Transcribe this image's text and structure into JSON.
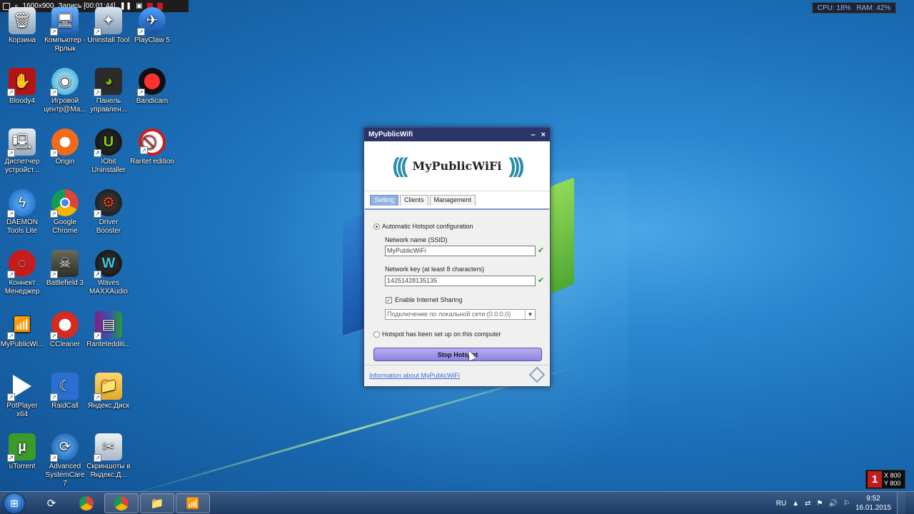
{
  "recorder": {
    "resolution": "1600x900",
    "recording": "Запись [00:01:44]"
  },
  "sysmon": {
    "cpu": "CPU: 18%",
    "ram": "RAM: 42%"
  },
  "desktop_icons": [
    {
      "label": "Корзина",
      "icon": "recycle-bin-icon"
    },
    {
      "label": "Компьютер - Ярлык",
      "icon": "computer-icon"
    },
    {
      "label": "Uninstall Tool",
      "icon": "uninstall-tool-icon"
    },
    {
      "label": "PlayClaw 5",
      "icon": "playclaw-icon"
    },
    {
      "label": "Bloody4",
      "icon": "bloody-icon"
    },
    {
      "label": "Игровой центр@Ma...",
      "icon": "game-center-icon"
    },
    {
      "label": "Панель управлен...",
      "icon": "nvidia-panel-icon"
    },
    {
      "label": "Bandicam",
      "icon": "bandicam-icon"
    },
    {
      "label": "Диспетчер устройст...",
      "icon": "device-manager-icon"
    },
    {
      "label": "Origin",
      "icon": "origin-icon"
    },
    {
      "label": "IObit Uninstaller",
      "icon": "iobit-icon"
    },
    {
      "label": "Raritet edition",
      "icon": "raritet-icon"
    },
    {
      "label": "DAEMON Tools Lite",
      "icon": "daemon-tools-icon"
    },
    {
      "label": "Google Chrome",
      "icon": "chrome-icon"
    },
    {
      "label": "Driver Booster",
      "icon": "driver-booster-icon"
    },
    {
      "label": "Коннект Менеджер",
      "icon": "connect-manager-icon"
    },
    {
      "label": "Battlefield 3",
      "icon": "battlefield-icon"
    },
    {
      "label": "Waves MAXXAudio",
      "icon": "waves-icon"
    },
    {
      "label": "MyPublicWi...",
      "icon": "mypublicwifi-icon"
    },
    {
      "label": "CCleaner",
      "icon": "ccleaner-icon"
    },
    {
      "label": "Raritetedditi...",
      "icon": "winrar-icon"
    },
    {
      "label": "PotPlayer x64",
      "icon": "potplayer-icon"
    },
    {
      "label": "RaidCall",
      "icon": "raidcall-icon"
    },
    {
      "label": "Яндекс.Диск",
      "icon": "yandex-disk-icon"
    },
    {
      "label": "uTorrent",
      "icon": "utorrent-icon"
    },
    {
      "label": "Advanced SystemCare 7",
      "icon": "systemcare-icon"
    },
    {
      "label": "Скриншоты в Яндекс.Д...",
      "icon": "screenshots-icon"
    }
  ],
  "window": {
    "title": "MyPublicWifi",
    "brand": "MyPublicWiFi",
    "tabs": [
      "Setting",
      "Clients",
      "Management"
    ],
    "auto_hotspot_label": "Automatic Hotspot configuration",
    "ssid_label": "Network name (SSID)",
    "ssid_value": "MyPublicWiFi",
    "key_label": "Network key (at least 8 characters)",
    "key_value": "14251428135135",
    "sharing_label": "Enable Internet Sharing",
    "connection_value": "Подключение по локальной сети (0.0.0.0)",
    "already_setup_label": "Hotspot has been set up on this computer",
    "stop_button": "Stop Hotspot",
    "info_link": "Information about MyPublicWiFi"
  },
  "coords": {
    "x": "X 800",
    "y": "Y 800",
    "badge": "1"
  },
  "taskbar": {
    "language": "RU",
    "time": "9:52",
    "date": "16.01.2015"
  }
}
